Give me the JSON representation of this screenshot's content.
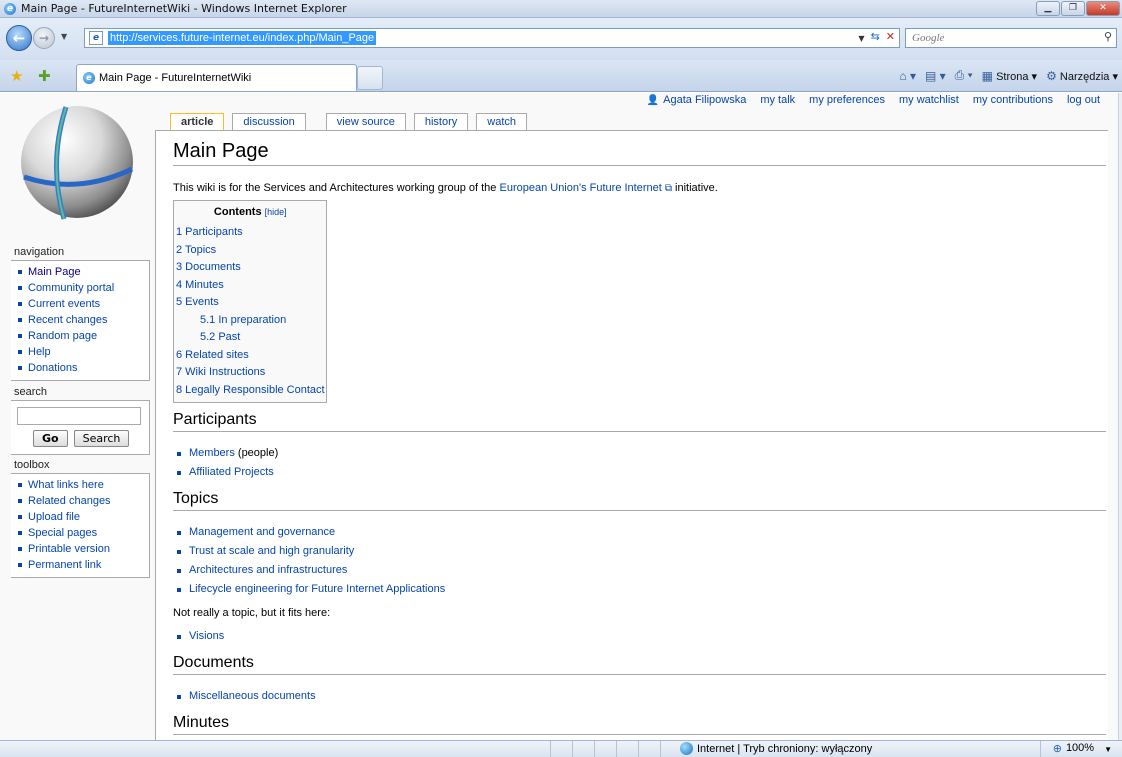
{
  "window": {
    "title": "Main Page - FutureInternetWiki - Windows Internet Explorer"
  },
  "address": {
    "url": "http://services.future-internet.eu/index.php/Main_Page"
  },
  "search_box": {
    "placeholder": "Google"
  },
  "tab": {
    "title": "Main Page - FutureInternetWiki"
  },
  "commandbar": {
    "page_label": "Strona",
    "tools_label": "Narzędzia"
  },
  "personal": {
    "user": "Agata Filipowska",
    "links": [
      "my talk",
      "my preferences",
      "my watchlist",
      "my contributions",
      "log out"
    ]
  },
  "content_actions": {
    "article": "article",
    "discussion": "discussion",
    "view_source": "view source",
    "history": "history",
    "watch": "watch"
  },
  "article": {
    "title": "Main Page",
    "intro_before": "This wiki is for the Services and Architectures working group of the ",
    "intro_link": "European Union's Future Internet",
    "intro_after": " initiative.",
    "toc_title": "Contents",
    "toc_hide": "[hide]",
    "toc": [
      {
        "label": "1 Participants",
        "sub": false
      },
      {
        "label": "2 Topics",
        "sub": false
      },
      {
        "label": "3 Documents",
        "sub": false
      },
      {
        "label": "4 Minutes",
        "sub": false
      },
      {
        "label": "5 Events",
        "sub": false
      },
      {
        "label": "5.1 In preparation",
        "sub": true
      },
      {
        "label": "5.2 Past",
        "sub": true
      },
      {
        "label": "6 Related sites",
        "sub": false
      },
      {
        "label": "7 Wiki Instructions",
        "sub": false
      },
      {
        "label": "8 Legally Responsible Contact",
        "sub": false
      }
    ],
    "participants": {
      "heading": "Participants",
      "members": "Members",
      "members_note": " (people)",
      "affiliated": "Affiliated Projects"
    },
    "topics": {
      "heading": "Topics",
      "items": [
        "Management and governance",
        "Trust at scale and high granularity",
        "Architectures and infrastructures",
        "Lifecycle engineering for Future Internet Applications"
      ],
      "note": "Not really a topic, but it fits here:",
      "extra": "Visions"
    },
    "documents": {
      "heading": "Documents",
      "items": [
        "Miscellaneous documents"
      ]
    },
    "minutes": {
      "heading": "Minutes"
    }
  },
  "sidebar": {
    "navigation": {
      "title": "navigation",
      "items": [
        "Main Page",
        "Community portal",
        "Current events",
        "Recent changes",
        "Random page",
        "Help",
        "Donations"
      ]
    },
    "search": {
      "title": "search",
      "go": "Go",
      "search": "Search"
    },
    "toolbox": {
      "title": "toolbox",
      "items": [
        "What links here",
        "Related changes",
        "Upload file",
        "Special pages",
        "Printable version",
        "Permanent link"
      ]
    }
  },
  "status": {
    "zone": "Internet | Tryb chroniony: wyłączony",
    "zoom": "100%"
  },
  "colors": {
    "link": "#0645ad",
    "visited": "#0b0080",
    "tab_selected_border": "#fabd23",
    "url_highlight": "#3399ff"
  }
}
